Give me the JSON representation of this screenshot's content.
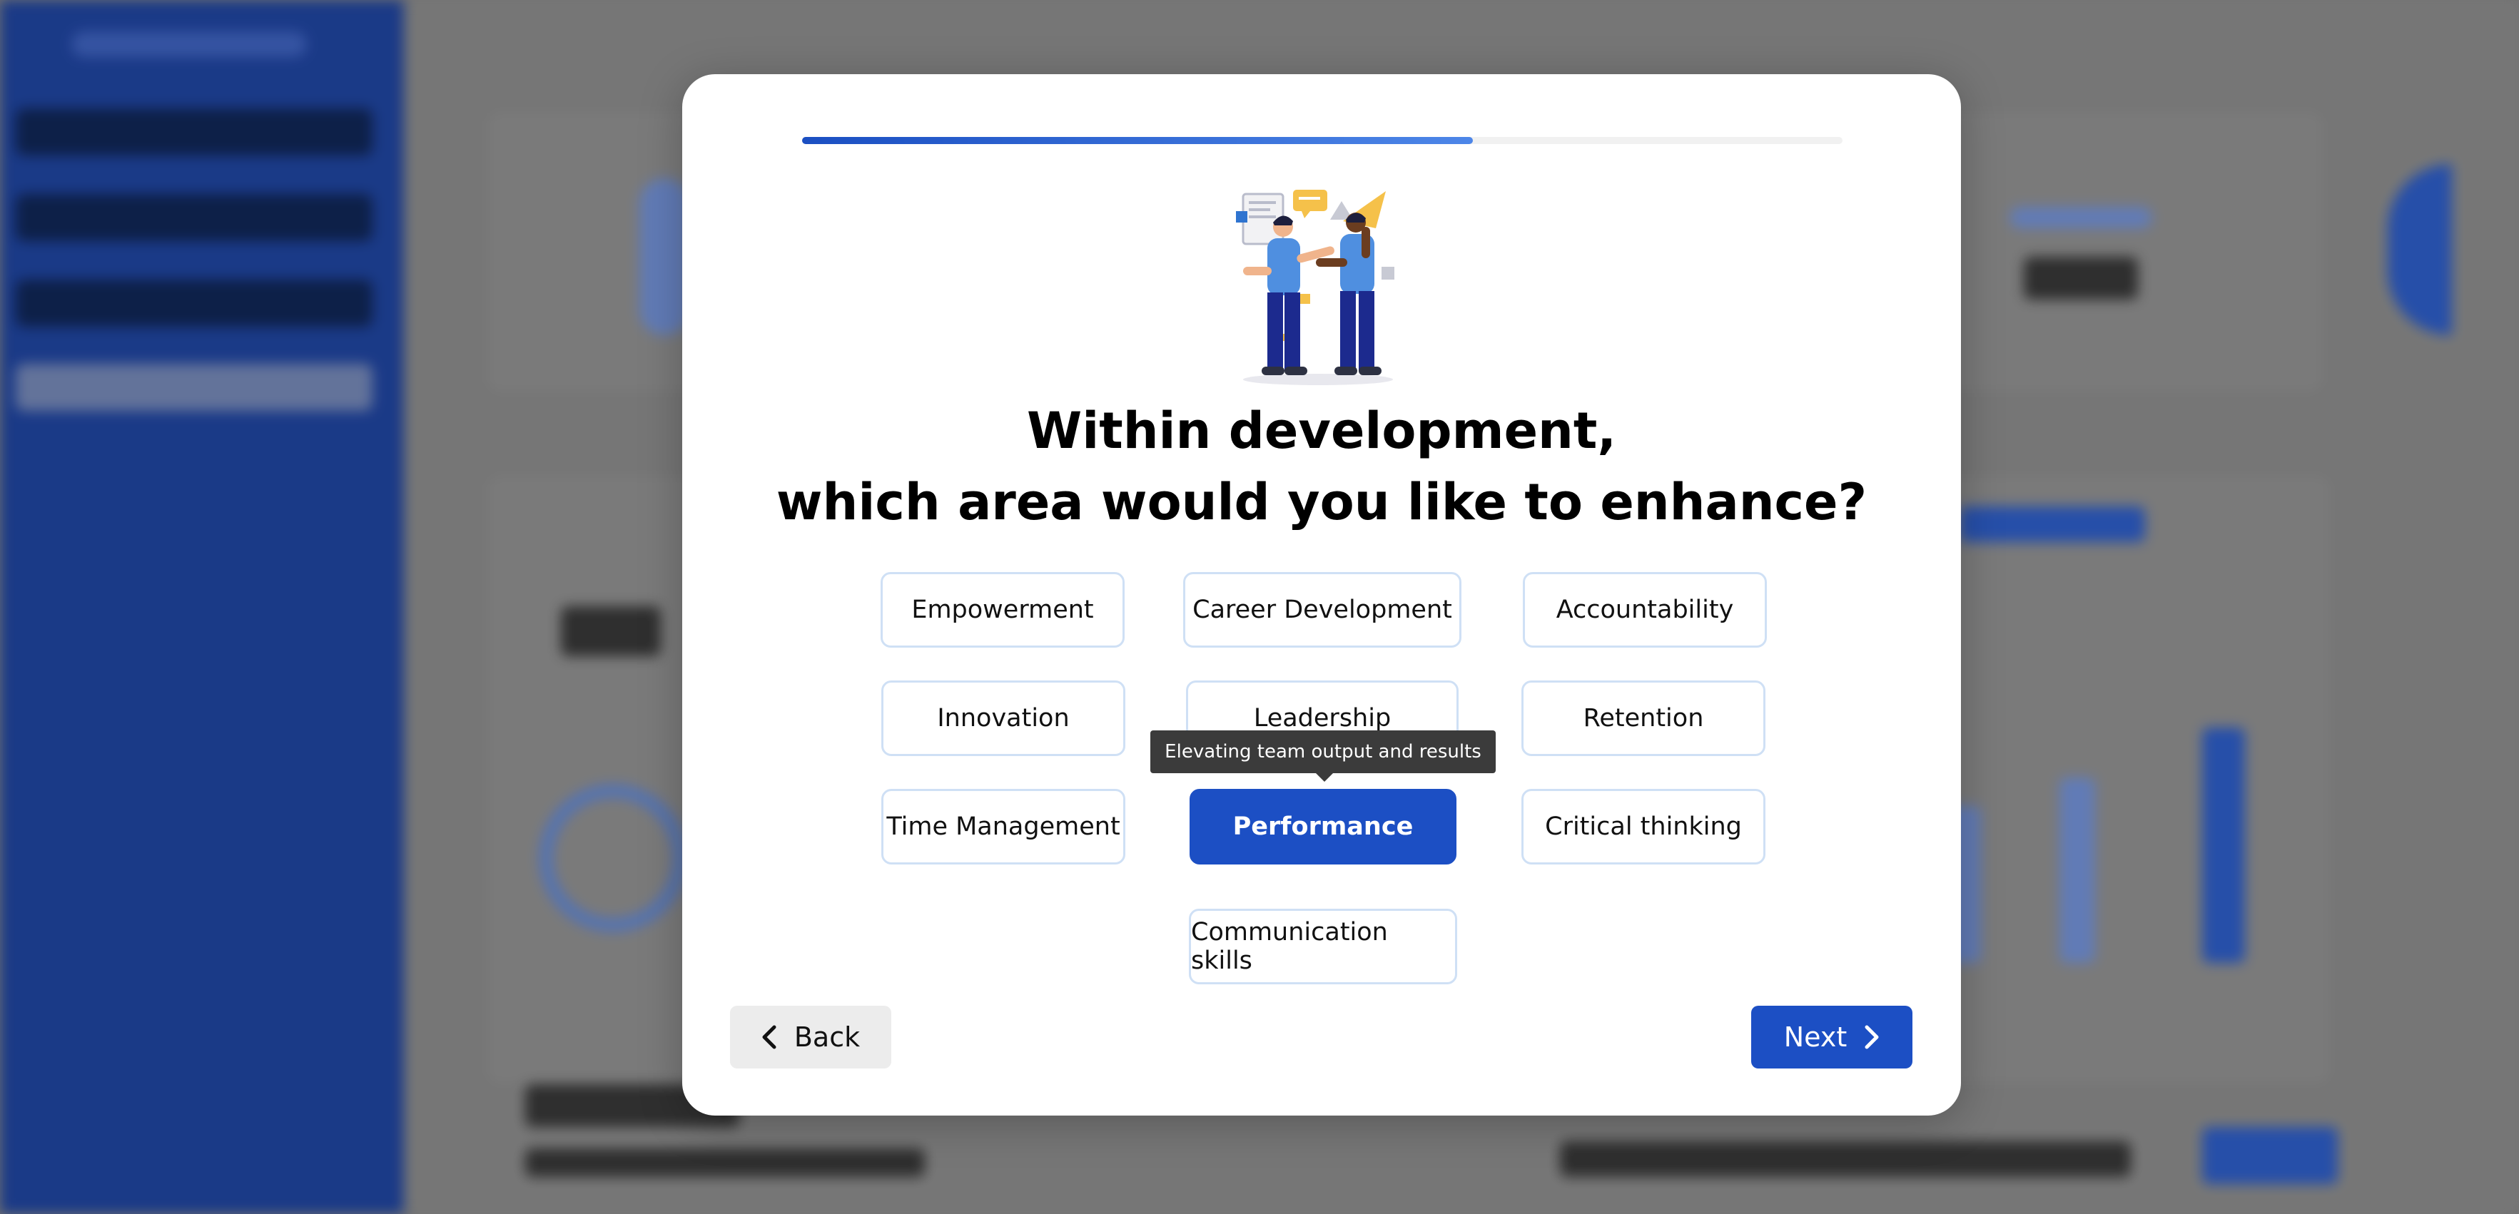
{
  "progress": {
    "fraction": 0.645
  },
  "question": {
    "line1": "Within development,",
    "line2": "which area would you like to enhance?"
  },
  "options": [
    {
      "label": "Empowerment"
    },
    {
      "label": "Career Development"
    },
    {
      "label": "Accountability"
    },
    {
      "label": "Innovation"
    },
    {
      "label": "Leadership"
    },
    {
      "label": "Retention"
    },
    {
      "label": "Time Management"
    },
    {
      "label": "Performance",
      "selected": true
    },
    {
      "label": "Critical thinking"
    },
    {
      "label": "Communication skills"
    }
  ],
  "tooltip": {
    "text": "Elevating team output and results"
  },
  "buttons": {
    "back_label": "Back",
    "next_label": "Next"
  },
  "icons": {
    "back": "chevron-left-icon",
    "next": "chevron-right-icon"
  },
  "colors": {
    "accent": "#1c4fc4",
    "option_border": "#cfe0f5",
    "tooltip_bg": "#3b3b3b"
  }
}
